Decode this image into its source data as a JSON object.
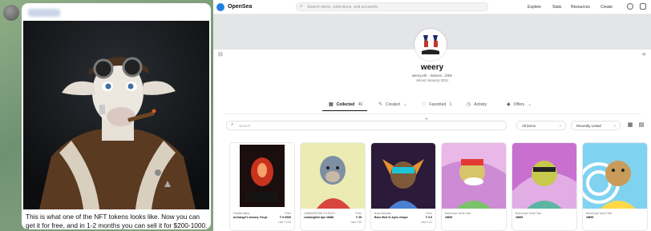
{
  "chat": {
    "sender_name": "blurred",
    "caption": "This is what one of the NFT tokens looks like. Now you can get it for free, and in 1-2 months you can sell it for $200-1000."
  },
  "opensea": {
    "brand": "OpenSea",
    "search_placeholder": "Search items, collections, and accounts",
    "nav": [
      "Explore",
      "Stats",
      "Resources",
      "Create"
    ],
    "profile": {
      "username": "weery",
      "address": "weery.eth · 0x6ec8...1f4fe",
      "joined": "Joined January 2021"
    },
    "tabs": [
      {
        "label": "Collected",
        "count": "46",
        "icon": "grid-icon"
      },
      {
        "label": "Created",
        "count": "",
        "icon": "brush-icon"
      },
      {
        "label": "Favorited",
        "count": "1",
        "icon": "heart-icon"
      },
      {
        "label": "Activity",
        "count": "",
        "icon": "clock-icon"
      },
      {
        "label": "Offers",
        "count": "",
        "icon": "tag-icon"
      }
    ],
    "filter_placeholder": "Search",
    "items_select": "All items",
    "sort_select": "Recently Listed",
    "cards": [
      {
        "collection": "Parallel Alpha",
        "name": "Archangel's Armory: Forge",
        "price_label": "Price",
        "price": "Ξ 0.0969",
        "last": "Last Ξ 0.06"
      },
      {
        "collection": "LAMBORGHINI STUDIOS",
        "name": "Lamborghini Ape #6488",
        "price_label": "Price",
        "price": "Ξ 35",
        "last": "Last Ξ 30"
      },
      {
        "collection": "Boss Beauties",
        "name": "Boss Wolf #1 Apes Unique",
        "price_label": "Price",
        "price": "Ξ 3.5",
        "last": "Last Ξ 3.1"
      },
      {
        "collection": "Bored Ape Yacht Club",
        "name": "#6699",
        "price_label": "",
        "price": "",
        "last": ""
      },
      {
        "collection": "Bored Ape Yacht Club",
        "name": "#6699",
        "price_label": "",
        "price": "",
        "last": ""
      },
      {
        "collection": "Bored Ape Yacht Club",
        "name": "#6699",
        "price_label": "",
        "price": "",
        "last": ""
      }
    ]
  },
  "colors": {
    "accent": "#2081e2",
    "chat_bg": "#7a9a77",
    "banner": "#e4e5e7"
  }
}
